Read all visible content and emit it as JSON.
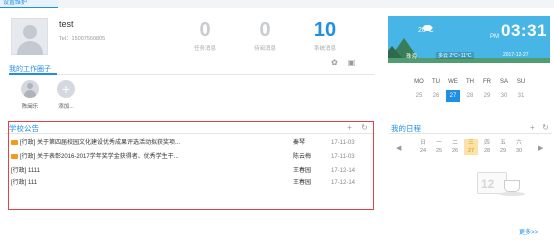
{
  "top_tab": {
    "label": "设置维护"
  },
  "profile": {
    "name": "test",
    "tel": "Tel：15007560805"
  },
  "stats": [
    {
      "value": "0",
      "label": "任务消息"
    },
    {
      "value": "0",
      "label": "待阅消息"
    },
    {
      "value": "10",
      "label": "系统消息"
    }
  ],
  "work_circle": {
    "title": "我的工作圈子",
    "members": [
      {
        "name": "陈闽乐"
      },
      {
        "name": "添加..."
      }
    ]
  },
  "weather": {
    "temperature": "20°C",
    "ampm": "PM",
    "time": "03:31",
    "city": "珠海",
    "desc": "多云 2°C~11°C",
    "date": "2017-12-27"
  },
  "calendar": {
    "weekdays": [
      "MO",
      "TU",
      "WE",
      "TH",
      "FR",
      "SA",
      "SU"
    ],
    "days": [
      "25",
      "26",
      "27",
      "28",
      "29",
      "30",
      "31"
    ],
    "today_index": 2
  },
  "notices": {
    "title": "学校公告",
    "items": [
      {
        "flag": true,
        "title": "[行政] 关于第四届校园文化建设优秀成果评选活动拟获奖项...",
        "author": "秦琴",
        "date": "17-11-03"
      },
      {
        "flag": true,
        "title": "[行政] 关于表彰2016-2017学年奖学金获得者、优秀学生干...",
        "author": "陈云梅",
        "date": "17-11-03"
      },
      {
        "flag": false,
        "title": "[行政] 1111",
        "author": "王春园",
        "date": "17-12-14"
      },
      {
        "flag": false,
        "title": "[行政] 111",
        "author": "王春园",
        "date": "17-12-14"
      }
    ]
  },
  "schedule": {
    "title": "我的日程",
    "days": [
      {
        "label": "日",
        "num": "24"
      },
      {
        "label": "一",
        "num": "25"
      },
      {
        "label": "二",
        "num": "26"
      },
      {
        "label": "三",
        "num": "27"
      },
      {
        "label": "四",
        "num": "28"
      },
      {
        "label": "五",
        "num": "29"
      },
      {
        "label": "六",
        "num": "30"
      }
    ],
    "selected_index": 3,
    "deco_number": "12",
    "more": "更多>>"
  },
  "colors": {
    "accent": "#1f8fe3",
    "highlight_border": "#e8404a",
    "flag": "#f29c1f"
  }
}
